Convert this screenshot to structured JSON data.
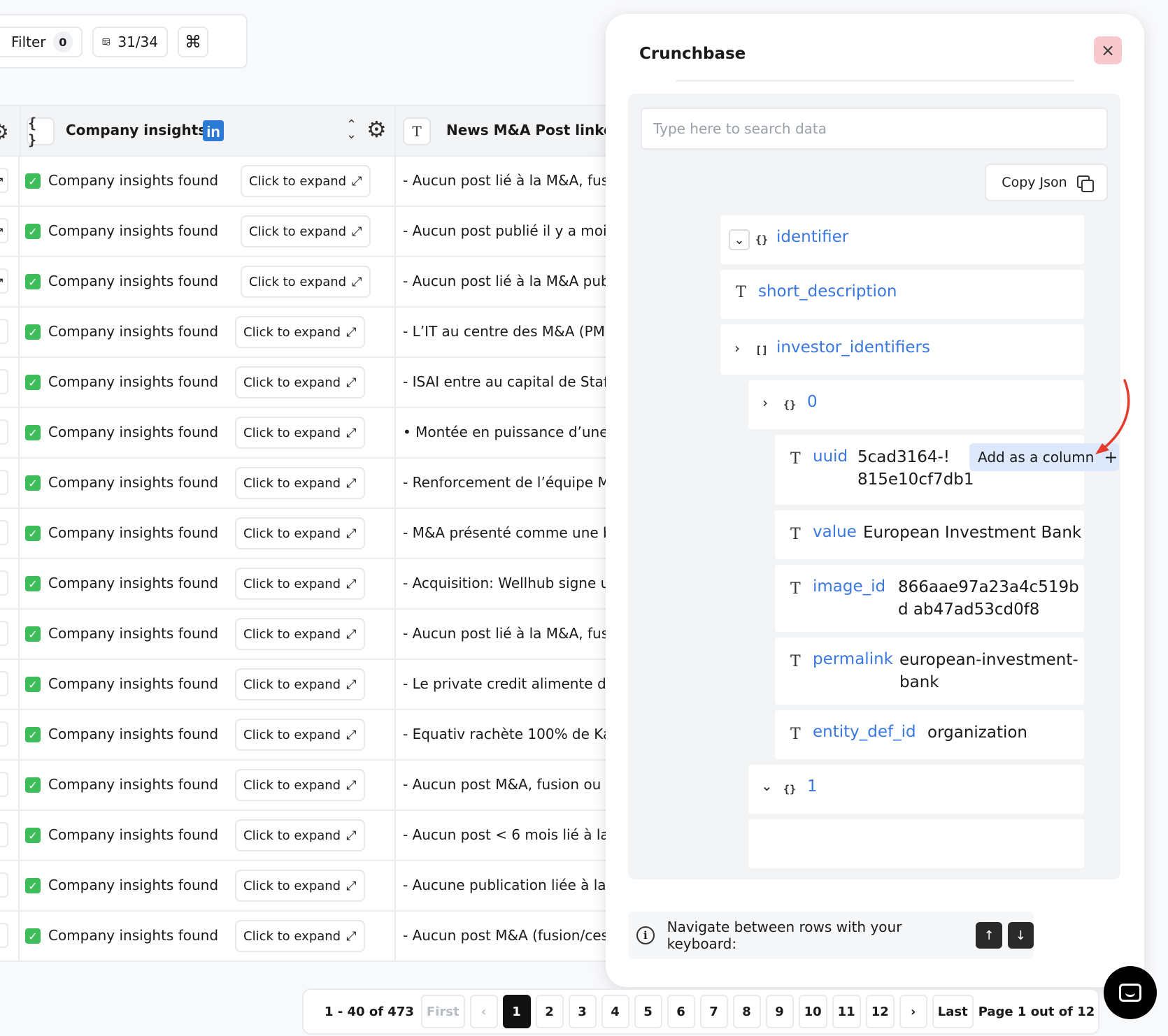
{
  "toolbar": {
    "filter_label": "Filter",
    "filter_count": "0",
    "columns_label": "31/34",
    "command_icon": "⌘"
  },
  "table": {
    "columns": {
      "insights_type": "{ }",
      "insights_title": "Company insights",
      "linkedin_badge": "in",
      "news_type": "T",
      "news_title": "News M&A Post linkedin"
    },
    "rows": [
      {
        "status": "Company insights found",
        "expand": "Click to expand",
        "news": "- Aucun post lié à la M&A, fusion"
      },
      {
        "status": "Company insights found",
        "expand": "Click to expand",
        "news": "- Aucun post publié il y a moins"
      },
      {
        "status": "Company insights found",
        "expand": "Click to expand",
        "news": "- Aucun post lié à la M&A pub"
      },
      {
        "status": "Company insights found",
        "expand": "Click to expand",
        "news": "- L’IT au centre des M&A (PMI,"
      },
      {
        "status": "Company insights found",
        "expand": "Click to expand",
        "news": "- ISAI entre au capital de Staff"
      },
      {
        "status": "Company insights found",
        "expand": "Click to expand",
        "news": "• Montée en puissance d’une «"
      },
      {
        "status": "Company insights found",
        "expand": "Click to expand",
        "news": "- Renforcement de l’équipe M&A"
      },
      {
        "status": "Company insights found",
        "expand": "Click to expand",
        "news": "- M&A présenté comme une b"
      },
      {
        "status": "Company insights found",
        "expand": "Click to expand",
        "news": "- Acquisition: Wellhub signe u"
      },
      {
        "status": "Company insights found",
        "expand": "Click to expand",
        "news": "- Aucun post lié à la M&A, fusion"
      },
      {
        "status": "Company insights found",
        "expand": "Click to expand",
        "news": "- Le private credit alimente de"
      },
      {
        "status": "Company insights found",
        "expand": "Click to expand",
        "news": "- Equativ rachète 100% de Kan"
      },
      {
        "status": "Company insights found",
        "expand": "Click to expand",
        "news": "- Aucun post M&A, fusion ou a"
      },
      {
        "status": "Company insights found",
        "expand": "Click to expand",
        "news": "- Aucun post < 6 mois lié à la M"
      },
      {
        "status": "Company insights found",
        "expand": "Click to expand",
        "news": "- Aucune publication liée à la"
      },
      {
        "status": "Company insights found",
        "expand": "Click to expand",
        "news": "- Aucun post M&A (fusion/ces"
      }
    ]
  },
  "panel": {
    "title": "Crunchbase",
    "close_icon": "×",
    "search_placeholder": "Type here to search data",
    "copy_json_label": "Copy Json",
    "tree": {
      "identifier_key": "identifier",
      "short_description_key": "short_description",
      "investor_identifiers_key": "investor_identifiers",
      "item0_key": "0",
      "uuid_key": "uuid",
      "uuid_value_line1": "5cad3164-!",
      "uuid_value_line2": "815e10cf7db1",
      "add_column_label": "Add as a column",
      "value_key": "value",
      "value_value": "European Investment Bank",
      "image_id_key": "image_id",
      "image_id_value": "866aae97a23a4c519bd ab47ad53cd0f8",
      "permalink_key": "permalink",
      "permalink_value": "european-investment- bank",
      "entity_def_id_key": "entity_def_id",
      "entity_def_id_value": "organization",
      "item1_key": "1"
    },
    "nav_hint": "Navigate between rows with your keyboard:"
  },
  "pagination": {
    "range": "1 - 40 of 473",
    "first": "First",
    "pages": [
      "1",
      "2",
      "3",
      "4",
      "5",
      "6",
      "7",
      "8",
      "9",
      "10",
      "11",
      "12"
    ],
    "last": "Last",
    "page_info": "Page 1 out of 12"
  },
  "colors": {
    "accent_blue": "#3a78e0",
    "check_green": "#3ebd5a",
    "close_bg": "#f7c9cd",
    "add_column_bg": "#dde8fb",
    "annotation_arrow": "#e53b2c"
  }
}
